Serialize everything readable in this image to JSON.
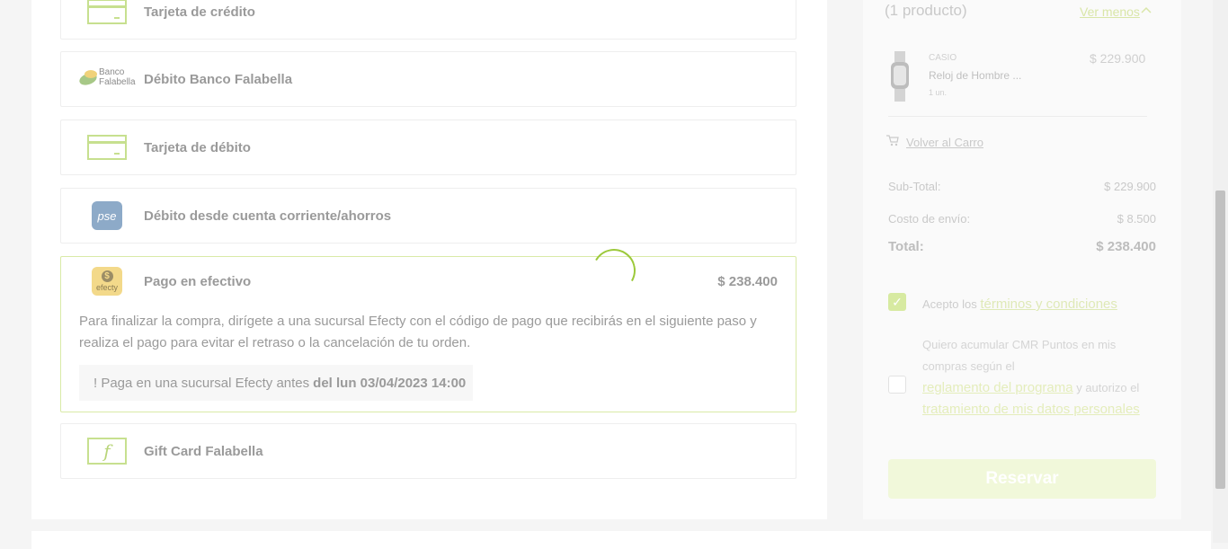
{
  "payment_options": {
    "credit_card": {
      "label": "Tarjeta de crédito"
    },
    "banco_falabella": {
      "label": "Débito Banco Falabella",
      "logo_line1": "Banco",
      "logo_line2": "Falabella"
    },
    "debit_card": {
      "label": "Tarjeta de débito"
    },
    "pse": {
      "label": "Débito desde cuenta corriente/ahorros",
      "logo_text": "pse"
    },
    "cash": {
      "label": "Pago en efectivo",
      "price": "$ 238.400",
      "logo_text": "efecty",
      "coin_symbol": "$",
      "description": "Para finalizar la compra, dirígete a una sucursal Efecty con el código de pago que recibirás en el siguiente paso y realiza el pago para evitar el retraso o la cancelación de tu orden.",
      "notice_prefix": "! Paga en una sucursal Efecty antes",
      "notice_deadline": "del lun 03/04/2023 14:00"
    },
    "gift_card": {
      "label": "Gift Card Falabella",
      "logo_glyph": "f"
    }
  },
  "summary": {
    "product_count": "(1 producto)",
    "toggle_label": "Ver menos",
    "product": {
      "brand": "CASIO",
      "name": "Reloj de Hombre ...",
      "quantity": "1 un.",
      "price": "$ 229.900"
    },
    "back_to_cart": "Volver al Carro",
    "subtotal_label": "Sub-Total:",
    "subtotal_value": "$ 229.900",
    "shipping_label": "Costo de envío:",
    "shipping_value": "$ 8.500",
    "total_label": "Total:",
    "total_value": "$ 238.400",
    "terms_prefix": "Acepto los",
    "terms_link": "términos y condiciones",
    "terms_checked": true,
    "cmr_text1": "Quiero acumular CMR Puntos en mis compras según el",
    "cmr_link1": "reglamento del programa",
    "cmr_text2": "y autorizo el",
    "cmr_link2": "tratamiento de mis datos personales",
    "cmr_checked": false,
    "submit_label": "Reservar"
  },
  "colors": {
    "accent_green": "#9cc93a",
    "icon_green": "#c7e08f"
  },
  "icons": {
    "card": "credit-card-icon",
    "cart": "cart-icon",
    "chevron": "chevron-up-icon",
    "spinner": "loading-spinner"
  }
}
